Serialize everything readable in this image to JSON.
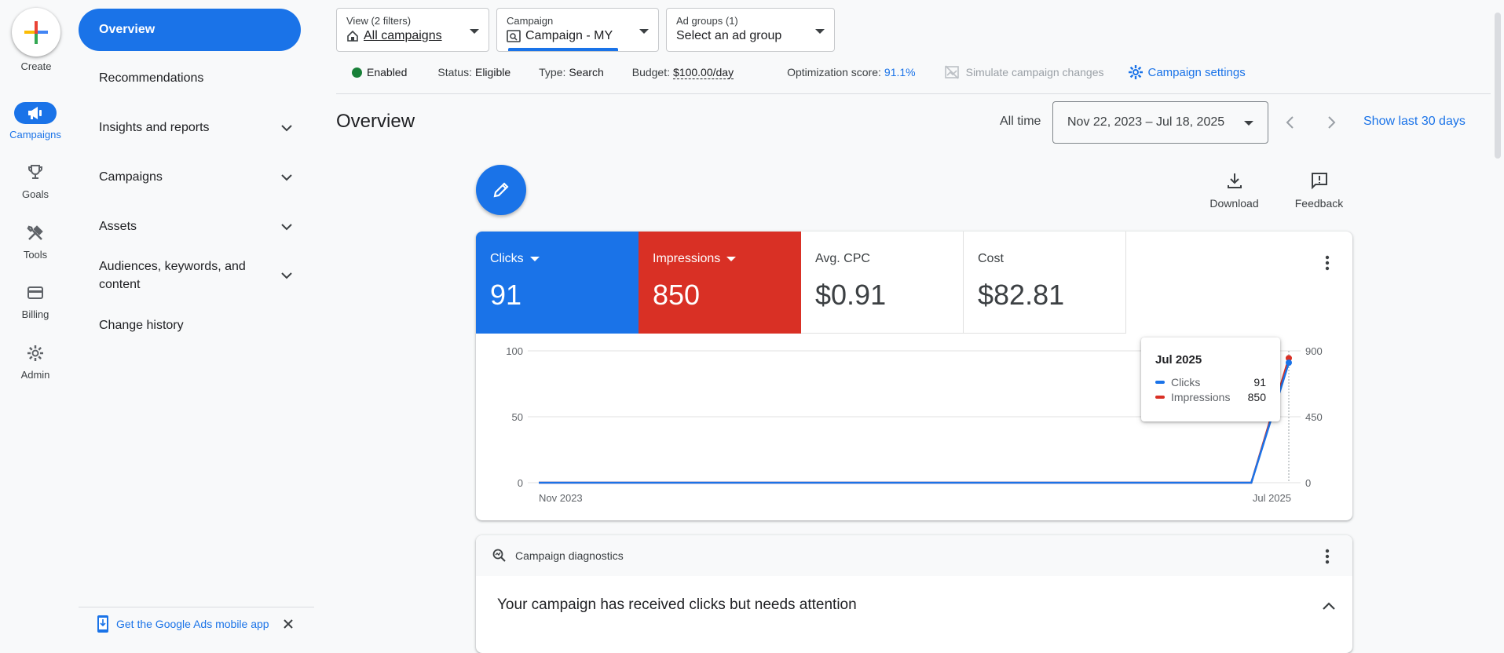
{
  "rail": {
    "create_label": "Create",
    "items": [
      {
        "label": "Campaigns",
        "icon": "megaphone-icon",
        "active": true
      },
      {
        "label": "Goals",
        "icon": "trophy-icon"
      },
      {
        "label": "Tools",
        "icon": "tools-icon"
      },
      {
        "label": "Billing",
        "icon": "credit-card-icon"
      },
      {
        "label": "Admin",
        "icon": "gear-icon"
      }
    ]
  },
  "nav": {
    "overview": "Overview",
    "items": [
      {
        "label": "Recommendations",
        "expandable": false
      },
      {
        "label": "Insights and reports",
        "expandable": true
      },
      {
        "label": "Campaigns",
        "expandable": true
      },
      {
        "label": "Assets",
        "expandable": true
      },
      {
        "label": "Audiences, keywords, and content",
        "expandable": true
      },
      {
        "label": "Change history",
        "expandable": false
      }
    ],
    "mobile_app": "Get the Google Ads mobile app"
  },
  "selectors": {
    "view_label": "View (2 filters)",
    "view_value": "All campaigns",
    "campaign_label": "Campaign",
    "campaign_value": "Campaign - MY",
    "adgroups_label": "Ad groups (1)",
    "adgroups_value": "Select an ad group"
  },
  "status": {
    "enabled": "Enabled",
    "status_label": "Status:",
    "status_value": "Eligible",
    "type_label": "Type:",
    "type_value": "Search",
    "budget_label": "Budget:",
    "budget_value": "$100.00/day",
    "opt_label": "Optimization score:",
    "opt_value": "91.1%",
    "simulate": "Simulate campaign changes",
    "settings": "Campaign settings"
  },
  "page": {
    "title": "Overview",
    "range_label": "All time",
    "date_range": "Nov 22, 2023 – Jul 18, 2025",
    "show_last": "Show last 30 days",
    "download": "Download",
    "feedback": "Feedback"
  },
  "metrics": [
    {
      "label": "Clicks",
      "value": "91",
      "color": "#1a73e8",
      "dropdown": true
    },
    {
      "label": "Impressions",
      "value": "850",
      "color": "#d93025",
      "dropdown": true
    },
    {
      "label": "Avg. CPC",
      "value": "$0.91"
    },
    {
      "label": "Cost",
      "value": "$82.81"
    }
  ],
  "tooltip": {
    "title": "Jul 2025",
    "rows": [
      {
        "name": "Clicks",
        "value": "91",
        "color": "#1a73e8"
      },
      {
        "name": "Impressions",
        "value": "850",
        "color": "#d93025"
      }
    ]
  },
  "chart_data": {
    "type": "line",
    "x": [
      "Nov 2023",
      "Dec 2023",
      "Jan 2024",
      "Feb 2024",
      "Mar 2024",
      "Apr 2024",
      "May 2024",
      "Jun 2024",
      "Jul 2024",
      "Aug 2024",
      "Sep 2024",
      "Oct 2024",
      "Nov 2024",
      "Dec 2024",
      "Jan 2025",
      "Feb 2025",
      "Mar 2025",
      "Apr 2025",
      "May 2025",
      "Jun 2025",
      "Jul 2025"
    ],
    "x_tick_labels": [
      "Nov 2023",
      "Jul 2025"
    ],
    "series": [
      {
        "name": "Clicks",
        "axis": "left",
        "color": "#1a73e8",
        "values": [
          0,
          0,
          0,
          0,
          0,
          0,
          0,
          0,
          0,
          0,
          0,
          0,
          0,
          0,
          0,
          0,
          0,
          0,
          0,
          0,
          91
        ]
      },
      {
        "name": "Impressions",
        "axis": "right",
        "color": "#d93025",
        "values": [
          0,
          0,
          0,
          0,
          0,
          0,
          0,
          0,
          0,
          0,
          0,
          0,
          0,
          0,
          0,
          0,
          0,
          0,
          0,
          0,
          850
        ]
      }
    ],
    "y_left": {
      "ticks": [
        0,
        50,
        100
      ],
      "range": [
        0,
        100
      ]
    },
    "y_right": {
      "ticks": [
        0,
        450,
        900
      ],
      "range": [
        0,
        900
      ]
    },
    "grid": true
  },
  "diagnostics": {
    "title": "Campaign diagnostics",
    "headline": "Your campaign has received clicks but needs attention"
  }
}
